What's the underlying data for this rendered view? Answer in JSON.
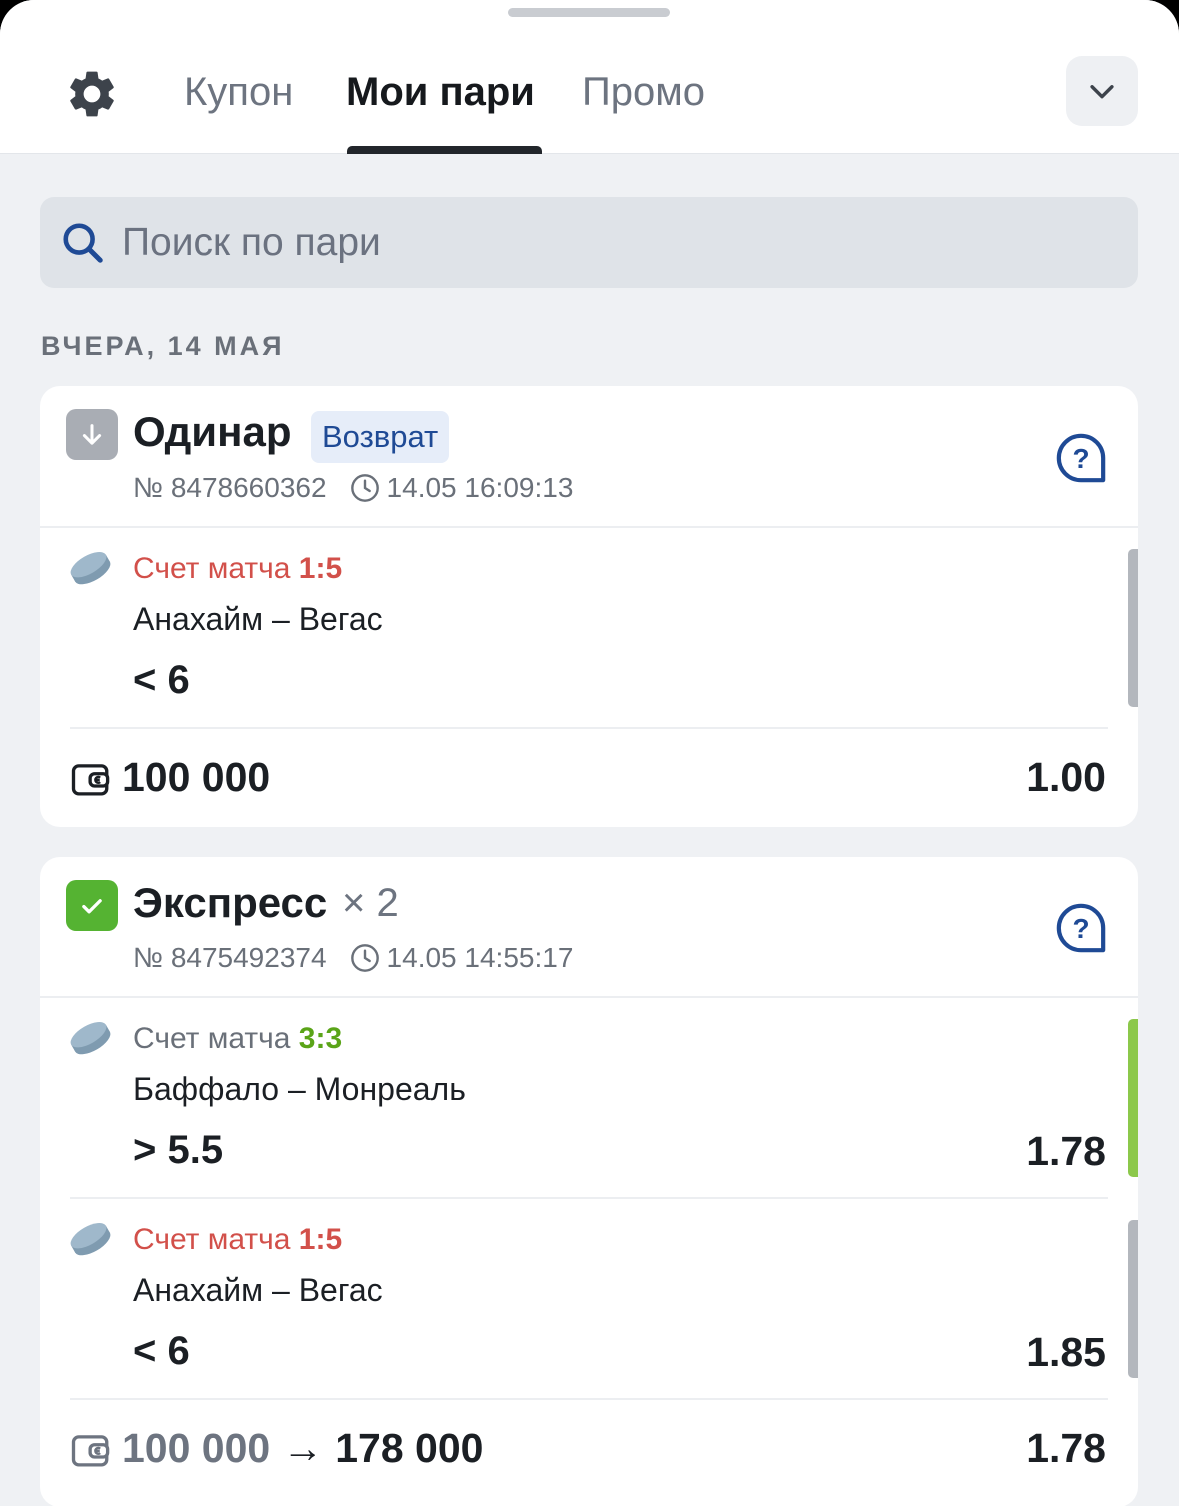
{
  "tabs": {
    "coupon": "Купон",
    "my_bets": "Мои пари",
    "promo": "Промо"
  },
  "search": {
    "placeholder": "Поиск по пари"
  },
  "date_header": "ВЧЕРА, 14 МАЯ",
  "bets": [
    {
      "type": "Одинар",
      "status_tag": "Возврат",
      "number": "№ 8478660362",
      "datetime": "14.05 16:09:13",
      "selections": [
        {
          "score_label": "Счет матча",
          "score": "1:5",
          "teams": "Анахайм – Вегас",
          "outcome": "< 6",
          "odds": ""
        }
      ],
      "stake": "100 000",
      "total_odds": "1.00"
    },
    {
      "type": "Экспресс",
      "multiplier": "× 2",
      "number": "№ 8475492374",
      "datetime": "14.05 14:55:17",
      "selections": [
        {
          "score_label": "Счет матча",
          "score": "3:3",
          "teams": "Баффало – Монреаль",
          "outcome": "> 5.5",
          "odds": "1.78"
        },
        {
          "score_label": "Счет матча",
          "score": "1:5",
          "teams": "Анахайм – Вегас",
          "outcome": "< 6",
          "odds": "1.85"
        }
      ],
      "stake": "100 000",
      "arrow": "→",
      "payout": "178 000",
      "total_odds": "1.78"
    }
  ],
  "colors": {
    "lost": "#d2504a",
    "won": "#5aa418",
    "refund_tag_bg": "#e6edf9",
    "brand_blue": "#1f4a95"
  },
  "icons": [
    "gear-icon",
    "chevron-down-icon",
    "search-icon",
    "arrow-down-icon",
    "check-icon",
    "help-icon",
    "clock-icon",
    "hockey-puck-icon",
    "wallet-icon"
  ]
}
